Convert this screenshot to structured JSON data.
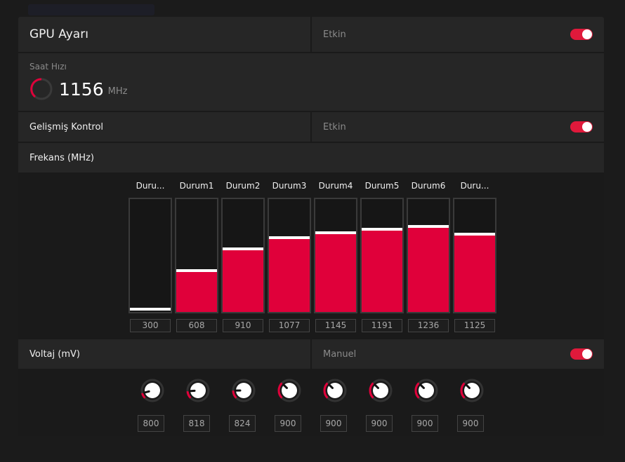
{
  "gpu": {
    "title": "GPU Ayarı",
    "status_label": "Etkin",
    "toggle_on": true
  },
  "clock": {
    "label": "Saat Hızı",
    "value": "1156",
    "unit": "MHz"
  },
  "advanced": {
    "title": "Gelişmiş Kontrol",
    "status_label": "Etkin",
    "toggle_on": true
  },
  "frequency": {
    "title": "Frekans (MHz)",
    "max_scale": 1600,
    "states": [
      {
        "label": "Duru...",
        "value": "300"
      },
      {
        "label": "Durum1",
        "value": "608"
      },
      {
        "label": "Durum2",
        "value": "910"
      },
      {
        "label": "Durum3",
        "value": "1077"
      },
      {
        "label": "Durum4",
        "value": "1145"
      },
      {
        "label": "Durum5",
        "value": "1191"
      },
      {
        "label": "Durum6",
        "value": "1236"
      },
      {
        "label": "Duru...",
        "value": "1125"
      }
    ]
  },
  "voltage": {
    "title": "Voltaj (mV)",
    "mode_label": "Manuel",
    "toggle_on": true,
    "values": [
      "800",
      "818",
      "824",
      "900",
      "900",
      "900",
      "900",
      "900"
    ]
  },
  "colors": {
    "accent": "#e0003a",
    "toggle": "#e0193b"
  }
}
